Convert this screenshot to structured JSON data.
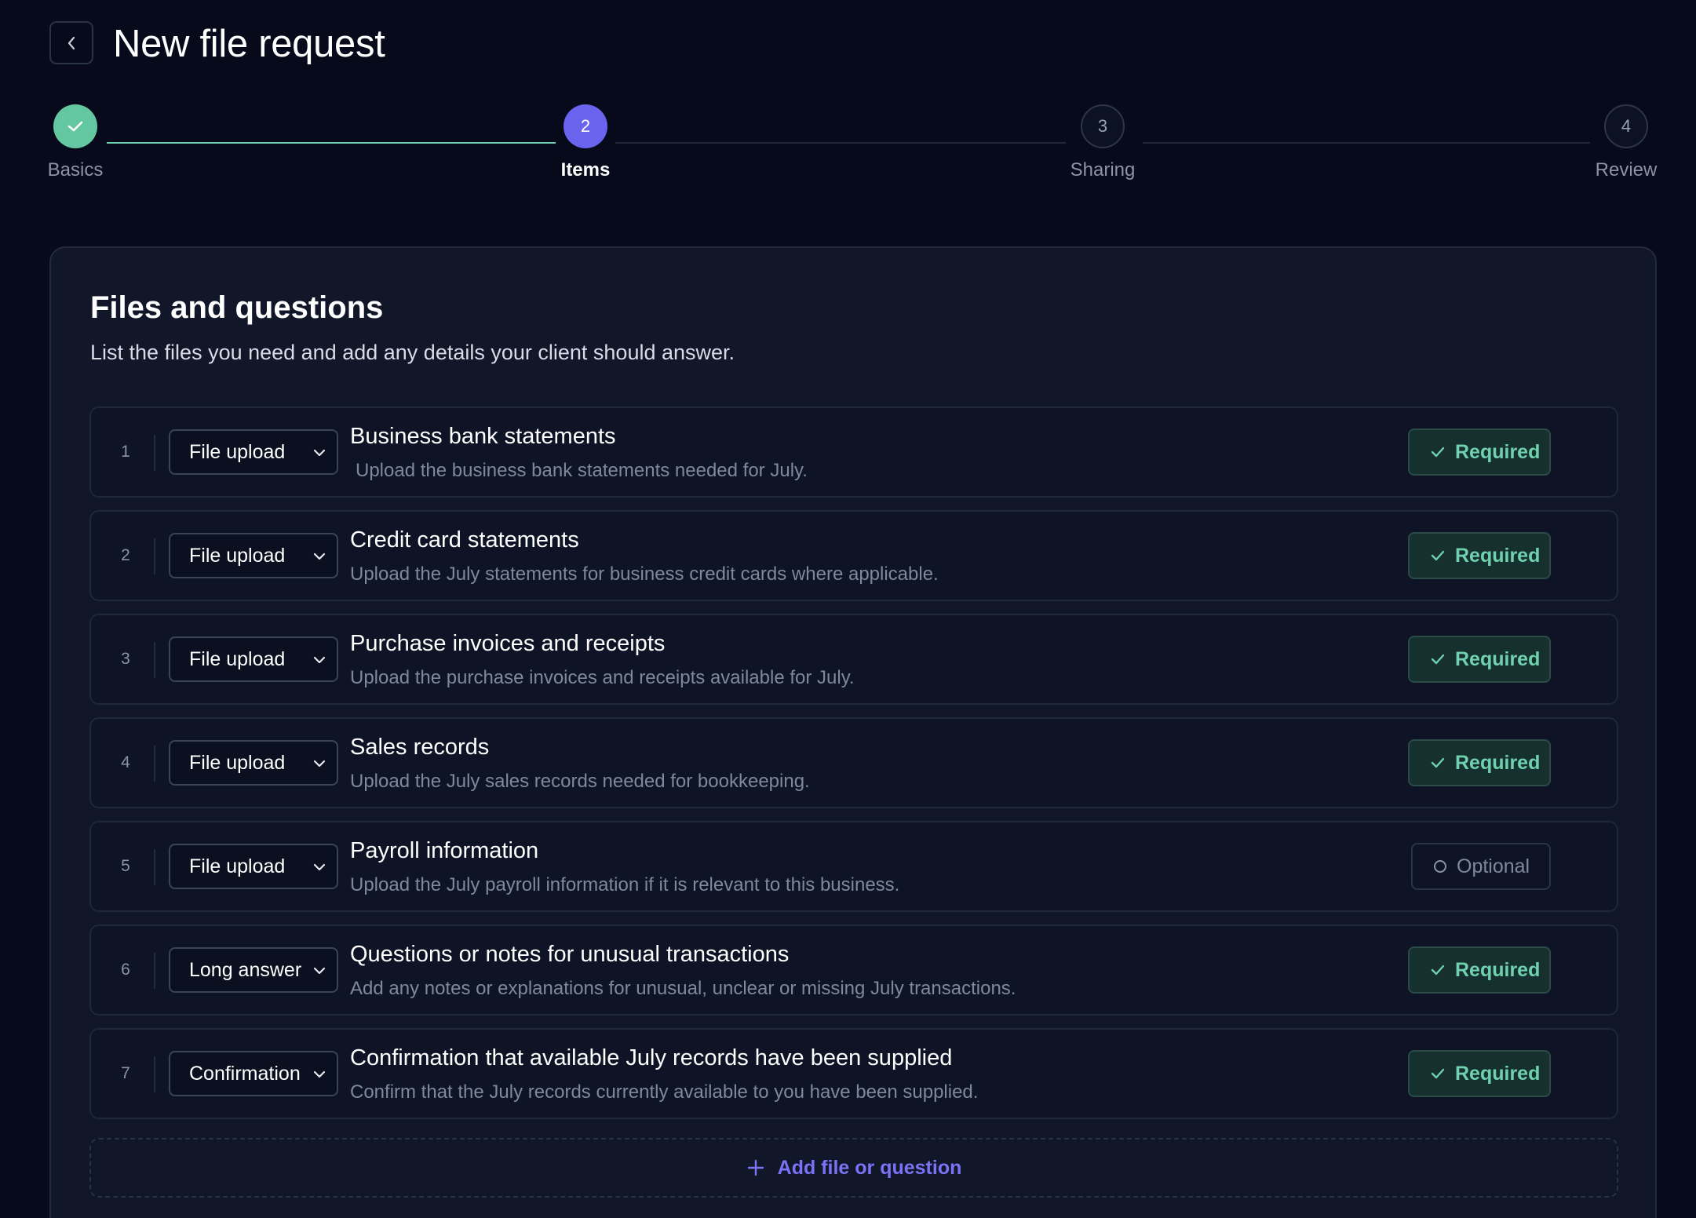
{
  "header": {
    "title": "New file request"
  },
  "stepper": {
    "steps": [
      {
        "number": "",
        "label": "Basics",
        "state": "done"
      },
      {
        "number": "2",
        "label": "Items",
        "state": "active"
      },
      {
        "number": "3",
        "label": "Sharing",
        "state": "todo"
      },
      {
        "number": "4",
        "label": "Review",
        "state": "todo"
      }
    ]
  },
  "card": {
    "title": "Files and questions",
    "subtitle": "List the files you need and add any details your client should answer."
  },
  "items": [
    {
      "num": "1",
      "type": "File upload",
      "title": "Business bank statements",
      "desc": "Upload the business bank statements needed for July.",
      "status": "Required"
    },
    {
      "num": "2",
      "type": "File upload",
      "title": "Credit card statements",
      "desc": "Upload the July statements for business credit cards where applicable.",
      "status": "Required"
    },
    {
      "num": "3",
      "type": "File upload",
      "title": "Purchase invoices and receipts",
      "desc": "Upload the purchase invoices and receipts available for July.",
      "status": "Required"
    },
    {
      "num": "4",
      "type": "File upload",
      "title": "Sales records",
      "desc": "Upload the July sales records needed for bookkeeping.",
      "status": "Required"
    },
    {
      "num": "5",
      "type": "File upload",
      "title": "Payroll information",
      "desc": "Upload the July payroll information if it is relevant to this business.",
      "status": "Optional"
    },
    {
      "num": "6",
      "type": "Long answer",
      "title": "Questions or notes for unusual transactions",
      "desc": "Add any notes or explanations for unusual, unclear or missing July transactions.",
      "status": "Required"
    },
    {
      "num": "7",
      "type": "Confirmation",
      "title": "Confirmation that available July records have been supplied",
      "desc": "Confirm that the July records currently available to you have been supplied.",
      "status": "Required"
    }
  ],
  "add_item": {
    "label": "Add file or question"
  },
  "colors": {
    "background": "#060a1a",
    "accent": "#6a63ee",
    "success": "#63c8a1",
    "card": "#111729"
  }
}
